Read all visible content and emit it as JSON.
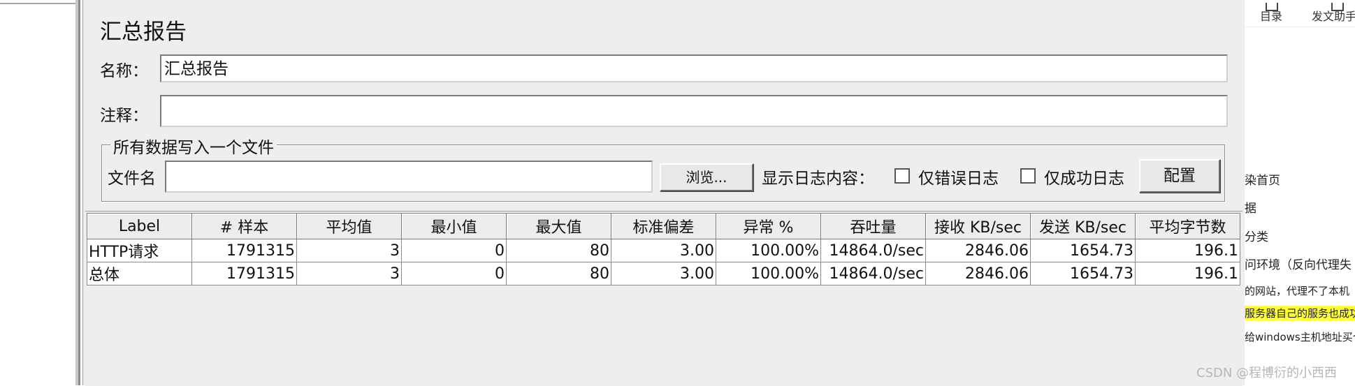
{
  "panel": {
    "title": "汇总报告",
    "name_label": "名称：",
    "name_value": "汇总报告",
    "comment_label": "注释：",
    "comment_value": ""
  },
  "file_group": {
    "legend": "所有数据写入一个文件",
    "filename_label": "文件名",
    "filename_value": "",
    "browse_button": "浏览...",
    "log_display_label": "显示日志内容：",
    "errors_only_label": "仅错误日志",
    "errors_only_checked": false,
    "success_only_label": "仅成功日志",
    "success_only_checked": false,
    "configure_button": "配置"
  },
  "table": {
    "columns": [
      "Label",
      "# 样本",
      "平均值",
      "最小值",
      "最大值",
      "标准偏差",
      "异常 %",
      "吞吐量",
      "接收 KB/sec",
      "发送 KB/sec",
      "平均字节数"
    ],
    "rows": [
      [
        "HTTP请求",
        "1791315",
        "3",
        "0",
        "80",
        "3.00",
        "100.00%",
        "14864.0/sec",
        "2846.06",
        "1654.73",
        "196.1"
      ],
      [
        "总体",
        "1791315",
        "3",
        "0",
        "80",
        "3.00",
        "100.00%",
        "14864.0/sec",
        "2846.06",
        "1654.73",
        "196.1"
      ]
    ]
  },
  "sidebar": {
    "toolbar": [
      {
        "label": "目录",
        "icon": "toc-icon"
      },
      {
        "label": "发文助手",
        "icon": "assistant-icon"
      }
    ],
    "toc_items": [
      {
        "text": "染首页",
        "highlight": false
      },
      {
        "text": "据",
        "highlight": false
      },
      {
        "text": "分类",
        "highlight": false
      },
      {
        "text": "问环境（反向代理失",
        "highlight": false
      },
      {
        "text": "的网站，代理不了本机",
        "highlight": false
      },
      {
        "text": "服务器自己的服务也成功",
        "highlight": true
      },
      {
        "text": "给windows主机地址买个",
        "highlight": false
      }
    ]
  },
  "watermark": "CSDN @程博衍的小西西",
  "colors": {
    "panel_bg": "#eeeeee",
    "highlight": "#ffff33",
    "watermark": "#b6b6b6"
  }
}
